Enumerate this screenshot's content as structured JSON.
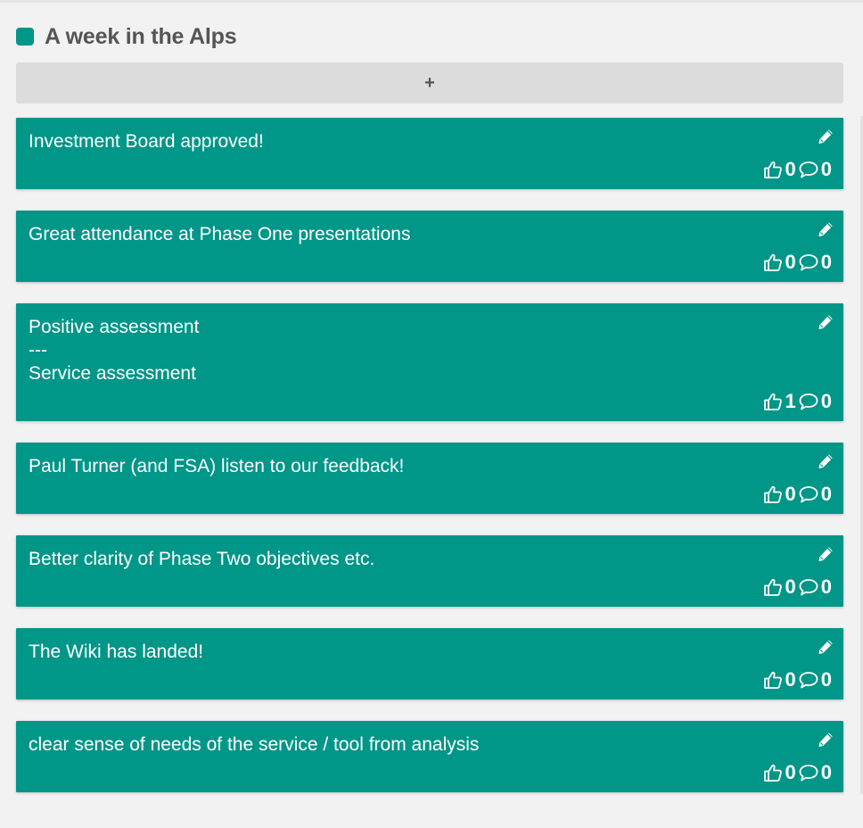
{
  "column": {
    "title": "A week in the Alps",
    "accent_color": "#009688",
    "add_label": "+"
  },
  "cards": [
    {
      "text": "Investment Board approved!",
      "votes": "0",
      "comments": "0"
    },
    {
      "text": "Great attendance at Phase One presentations",
      "votes": "0",
      "comments": "0"
    },
    {
      "text": "Positive assessment\n---\nService assessment",
      "votes": "1",
      "comments": "0"
    },
    {
      "text": "Paul Turner (and FSA) listen to our feedback!",
      "votes": "0",
      "comments": "0"
    },
    {
      "text": "Better clarity of Phase Two objectives etc.",
      "votes": "0",
      "comments": "0"
    },
    {
      "text": "The Wiki has landed!",
      "votes": "0",
      "comments": "0"
    },
    {
      "text": "clear sense of needs of the service / tool from analysis",
      "votes": "0",
      "comments": "0"
    }
  ],
  "icons": {
    "edit": "pencil-icon",
    "vote": "thumbs-up-icon",
    "comment": "speech-bubble-icon"
  }
}
